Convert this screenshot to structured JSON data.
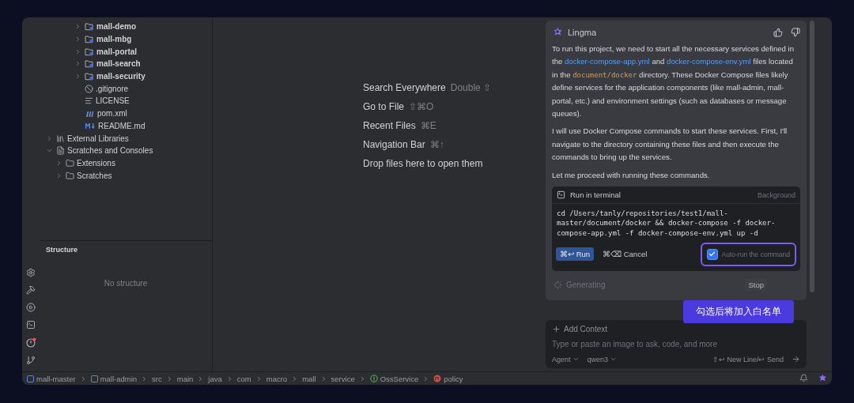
{
  "project_tree": {
    "module_contents": [
      {
        "label": "mall-demo",
        "kind": "module",
        "expanded": false
      },
      {
        "label": "mall-mbg",
        "kind": "module",
        "expanded": false
      },
      {
        "label": "mall-portal",
        "kind": "module",
        "expanded": false
      },
      {
        "label": "mall-search",
        "kind": "module",
        "expanded": false
      },
      {
        "label": "mall-security",
        "kind": "module",
        "expanded": false
      },
      {
        "label": ".gitignore",
        "kind": "ignore"
      },
      {
        "label": "LICENSE",
        "kind": "text"
      },
      {
        "label": "pom.xml",
        "kind": "maven"
      },
      {
        "label": "README.md",
        "kind": "markdown"
      }
    ],
    "roots": [
      {
        "label": "External Libraries",
        "kind": "library",
        "expanded": false
      },
      {
        "label": "Scratches and Consoles",
        "kind": "scratches",
        "expanded": true,
        "children": [
          {
            "label": "Extensions",
            "kind": "folder",
            "expanded": false
          },
          {
            "label": "Scratches",
            "kind": "folder",
            "expanded": false
          }
        ]
      }
    ]
  },
  "structure": {
    "title": "Structure",
    "empty_text": "No structure"
  },
  "editor_hints": [
    {
      "label": "Search Everywhere",
      "shortcut": "Double ⇧"
    },
    {
      "label": "Go to File",
      "shortcut": "⇧⌘O"
    },
    {
      "label": "Recent Files",
      "shortcut": "⌘E"
    },
    {
      "label": "Navigation Bar",
      "shortcut": "⌘↑"
    },
    {
      "label": "Drop files here to open them"
    }
  ],
  "chat": {
    "assistant": "Lingma",
    "paragraphs": [
      [
        {
          "kind": "text",
          "text": "To run this project, we need to start all the necessary services defined in the "
        },
        {
          "kind": "link",
          "text": "docker-compose-app.yml"
        },
        {
          "kind": "text",
          "text": " and "
        },
        {
          "kind": "link",
          "text": "docker-compose-env.yml"
        },
        {
          "kind": "text",
          "text": " files located in the "
        },
        {
          "kind": "code",
          "text": "document/docker"
        },
        {
          "kind": "text",
          "text": " directory. These Docker Compose files likely define services for the application components (like mall-admin, mall-portal, etc.) and environment settings (such as databases or message queues)."
        }
      ],
      [
        {
          "kind": "text",
          "text": "I will use Docker Compose commands to start these services. First, I'll navigate to the directory containing these files and then execute the commands to bring up the services."
        }
      ],
      [
        {
          "kind": "text",
          "text": "Let me proceed with running these commands."
        }
      ]
    ],
    "terminal": {
      "title": "Run in terminal",
      "mode": "Background",
      "command": "cd /Users/tanly/repositories/test1/mall-master/document/docker && docker-compose -f docker-compose-app.yml -f docker-compose-env.yml up -d",
      "run_label": "⌘↩ Run",
      "cancel_label": "⌘⌫ Cancel",
      "auto_run": {
        "label": "Auto-run the command",
        "checked": true
      }
    },
    "status": "Generating",
    "stop_label": "Stop",
    "tooltip": "勾选后将加入白名单",
    "input": {
      "add_context": "Add Context",
      "placeholder": "Type or paste an image to ask, code, and more",
      "mode": "Agent",
      "model": "qwen3",
      "hint": "⇧↩ New Line/↩ Send"
    }
  },
  "breadcrumbs": [
    {
      "label": "mall-master",
      "kind": "module"
    },
    {
      "label": "mall-admin",
      "kind": "module"
    },
    {
      "label": "src",
      "kind": "plain"
    },
    {
      "label": "main",
      "kind": "plain"
    },
    {
      "label": "java",
      "kind": "plain"
    },
    {
      "label": "com",
      "kind": "plain"
    },
    {
      "label": "macro",
      "kind": "plain"
    },
    {
      "label": "mall",
      "kind": "plain"
    },
    {
      "label": "service",
      "kind": "plain"
    },
    {
      "label": "OssService",
      "kind": "interface"
    },
    {
      "label": "policy",
      "kind": "method"
    }
  ]
}
